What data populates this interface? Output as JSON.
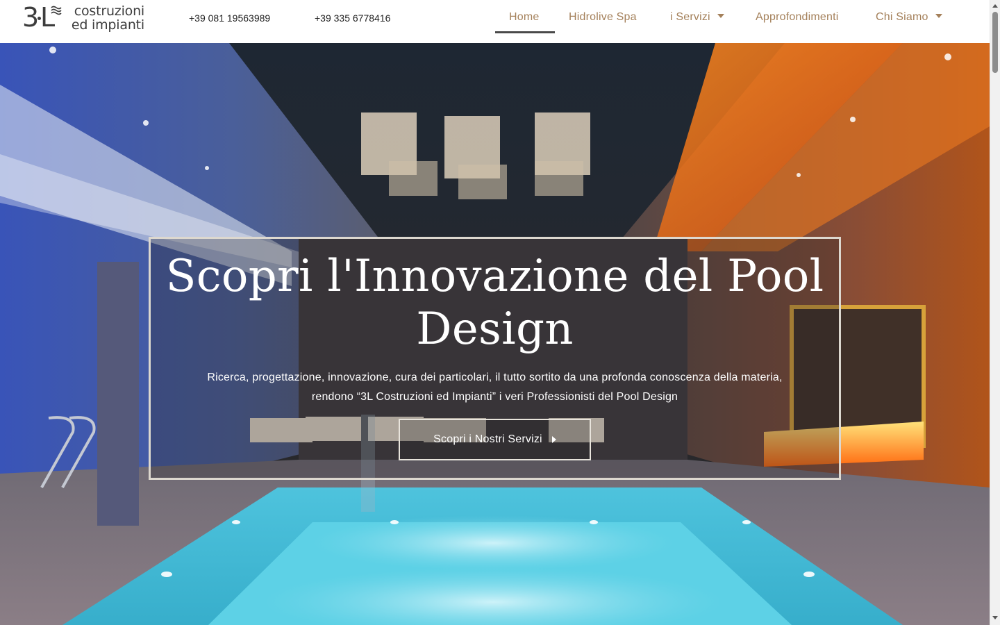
{
  "header": {
    "logo": {
      "mark": "3L",
      "line1": "costruzioni",
      "line2": "ed impianti"
    },
    "phones": [
      "+39 081 19563989",
      "+39 335 6778416"
    ],
    "nav": [
      {
        "label": "Home",
        "active": true,
        "has_dropdown": false
      },
      {
        "label": "Hidrolive Spa",
        "active": false,
        "has_dropdown": false
      },
      {
        "label": "i Servizi",
        "active": false,
        "has_dropdown": true
      },
      {
        "label": "Approfondimenti",
        "active": false,
        "has_dropdown": false
      },
      {
        "label": "Chi Siamo",
        "active": false,
        "has_dropdown": true
      }
    ]
  },
  "hero": {
    "title_line1": "Scopri l'Innovazione del Pool",
    "title_line2": "Design",
    "text_line1": "Ricerca, progettazione, innovazione, cura dei particolari, il tutto sortito da una profonda conoscenza della materia,",
    "text_line2": "rendono “3L Costruzioni ed Impianti” i veri Professionisti del Pool Design",
    "button_label": "Scopri i Nostri Servizi",
    "button_icon": "caret-right-icon"
  },
  "colors": {
    "nav_text": "#a4805a",
    "nav_active_underline": "#4a4a4a",
    "logo": "#3c3c3c",
    "hero_border": "#ddd8cf",
    "pool_water": "#5fd3e8"
  }
}
